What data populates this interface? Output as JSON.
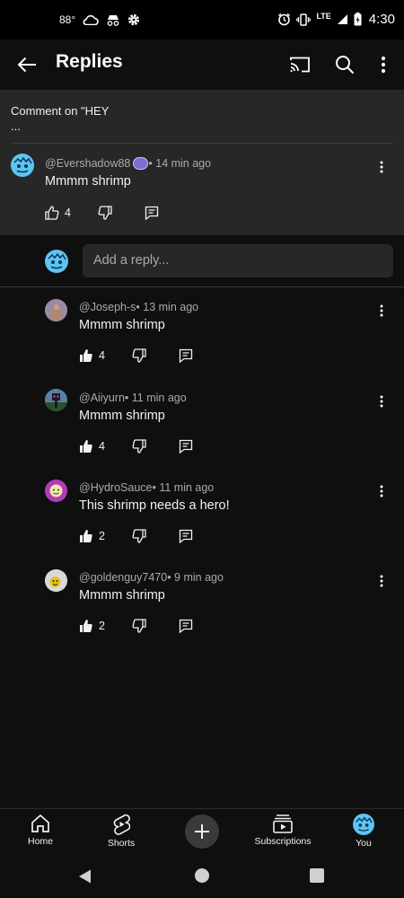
{
  "status_bar": {
    "temperature": "88°",
    "network": "LTE",
    "time": "4:30"
  },
  "app_bar": {
    "title": "Replies"
  },
  "parent": {
    "comment_on": "Comment on \"HEY\n...",
    "author": "@Evershadow88",
    "time": " • 14 min ago",
    "text": "Mmmm shrimp",
    "likes": "4"
  },
  "reply_box": {
    "placeholder": "Add a reply..."
  },
  "replies": [
    {
      "author": "@Joseph-s",
      "time": " • 13 min ago",
      "text": "Mmmm shrimp",
      "likes": "4"
    },
    {
      "author": "@Aiiyurn",
      "time": " • 11 min ago",
      "text": "Mmmm shrimp",
      "likes": "4"
    },
    {
      "author": "@HydroSauce",
      "time": " • 11 min ago",
      "text": "This shrimp needs a hero!",
      "likes": "2"
    },
    {
      "author": "@goldenguy7470",
      "time": " • 9 min ago",
      "text": "Mmmm shrimp",
      "likes": "2"
    }
  ],
  "bottom_nav": {
    "home": "Home",
    "shorts": "Shorts",
    "subscriptions": "Subscriptions",
    "you": "You"
  },
  "colors": {
    "background": "#0f0f0f",
    "surface": "#272727",
    "text": "#f1f1f1",
    "secondary_text": "#aaaaaa"
  }
}
